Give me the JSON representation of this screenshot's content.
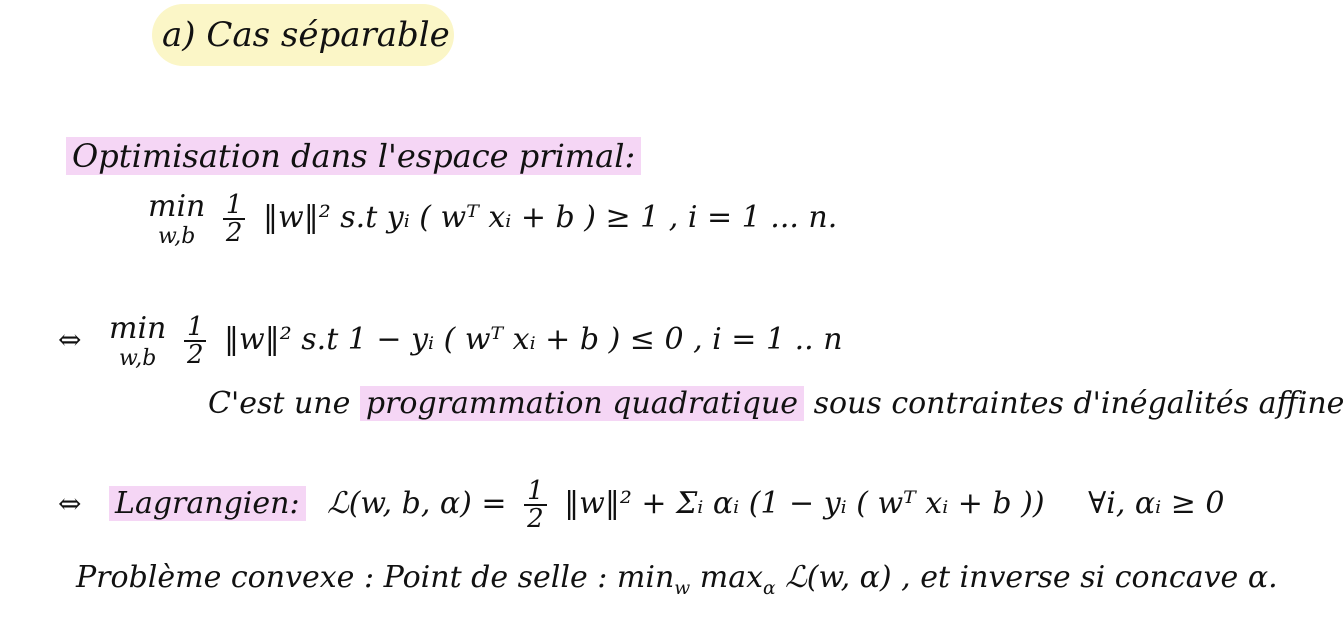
{
  "section": {
    "title": "a) Cas séparable"
  },
  "primal": {
    "heading": "Optimisation dans l'espace primal:",
    "eq1": {
      "op": "min",
      "vars": "w,b",
      "num": "1",
      "den": "2",
      "body": "‖w‖² s.t  yᵢ ( wᵀ xᵢ + b ) ≥ 1 ,   i = 1 ... n."
    },
    "equiv_symbol": "⇔",
    "eq2": {
      "op": "min",
      "vars": "w,b",
      "num": "1",
      "den": "2",
      "body": "‖w‖² s.t  1 − yᵢ ( wᵀ xᵢ + b ) ≤ 0 ,  i = 1 .. n"
    },
    "remark_prefix": "C'est une",
    "remark_highlight": "programmation quadratique",
    "remark_suffix": "sous contraintes d'inégalités affines."
  },
  "lagrangian": {
    "equiv_symbol": "⇔",
    "label": "Lagrangien:",
    "lhs": "ℒ(w, b, α) =",
    "num": "1",
    "den": "2",
    "rhs": "‖w‖² + Σᵢ αᵢ (1 − yᵢ ( wᵀ xᵢ + b ))",
    "condition": "∀i, αᵢ ≥ 0"
  },
  "conclusion": {
    "text": "Problème convexe : Point de selle :  min",
    "min_sub": "w",
    "max": "max",
    "max_sub": "α",
    "expr": "ℒ(w, α) , et inverse si concave α."
  }
}
